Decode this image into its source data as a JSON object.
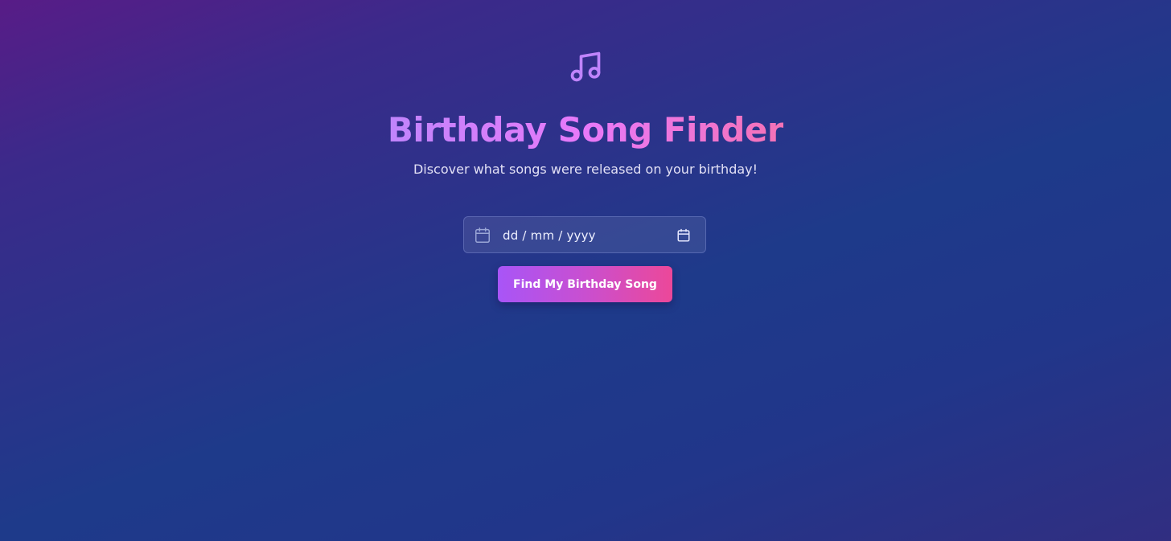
{
  "header": {
    "icon": "music-note-icon",
    "title": "Birthday Song Finder",
    "subtitle": "Discover what songs were released on your birthday!"
  },
  "form": {
    "date_input": {
      "placeholder": "dd / mm / yyyy",
      "value": "",
      "leading_icon": "calendar-icon",
      "trailing_icon": "calendar-picker-icon"
    },
    "submit_label": "Find My Birthday Song"
  },
  "colors": {
    "accent_purple": "#a855f7",
    "accent_pink": "#ec4899",
    "icon_purple": "#c084fc",
    "background_start": "#581c87",
    "background_end": "#1e3a8a"
  }
}
